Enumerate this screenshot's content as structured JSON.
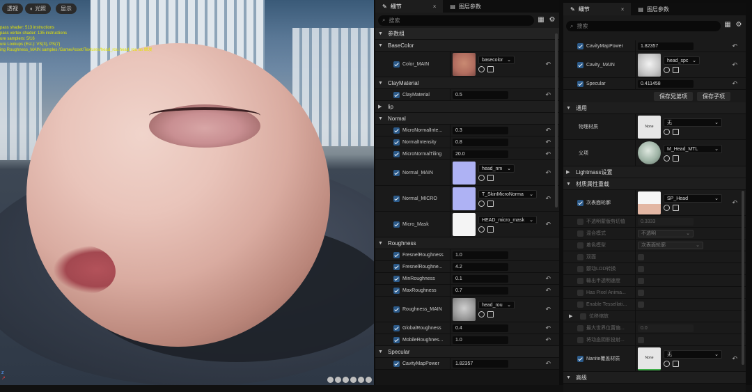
{
  "viewport": {
    "btn_perspective": "透视",
    "btn_lit": "光照",
    "btn_show": "显示",
    "stats": [
      "pass shader: 513 instructions",
      "pass vertex shader: 135 instructions",
      "ure samplers: 5/16",
      "ure Lookups (Est.): VS(3), PS(7)",
      "ing Roughness_MAIN samples /Game/Asset/Textures/head_rou.head_rou as 继发"
    ]
  },
  "panel1": {
    "tab_details": "细节",
    "tab_layer_params": "图层参数",
    "search_placeholder": "搜索",
    "params_group": "参数组",
    "sections": {
      "basecolor": "BaseColor",
      "claymaterial": "ClayMaterial",
      "lip": "lip",
      "normal": "Normal",
      "roughness": "Roughness",
      "specular": "Specular"
    },
    "color_main": {
      "label": "Color_MAIN",
      "asset": "basecolor"
    },
    "claymaterial": {
      "label": "ClayMaterial",
      "value": "0.5"
    },
    "micro_normal_intensity": {
      "label": "MicroNormalInte...",
      "value": "0.3"
    },
    "normal_intensity": {
      "label": "NormalIntensity",
      "value": "0.8"
    },
    "micro_normal_tiling": {
      "label": "MicroNormalTiling",
      "value": "20.0"
    },
    "normal_main": {
      "label": "Normal_MAIN",
      "asset": "head_nm"
    },
    "normal_micro": {
      "label": "Normal_MICRO",
      "asset": "T_SkinMicroNorma"
    },
    "micro_mask": {
      "label": "Micro_Mask",
      "asset": "HEAD_micro_mask"
    },
    "fresnel_roughness": {
      "label": "FresnelRoughness",
      "value": "1.0"
    },
    "fresnel_roughness2": {
      "label": "FresnelRoughne...",
      "value": "4.2"
    },
    "min_roughness": {
      "label": "MinRoughness",
      "value": "0.1"
    },
    "max_roughness": {
      "label": "MaxRoughness",
      "value": "0.7"
    },
    "roughness_main": {
      "label": "Roughness_MAIN",
      "asset": "head_rou"
    },
    "global_roughness": {
      "label": "GlobalRoughness",
      "value": "0.4"
    },
    "mobile_roughness": {
      "label": "MobileRoughnes...",
      "value": "1.0"
    },
    "cavity_map_power": {
      "label": "CavityMapPower",
      "value": "1.82357"
    }
  },
  "panel2": {
    "tab_details": "细节",
    "tab_layer_params": "图层参数",
    "search_placeholder": "搜索",
    "cavity_map_power": {
      "label": "CavityMapPower",
      "value": "1.82357"
    },
    "cavity_main": {
      "label": "Cavity_MAIN",
      "asset": "head_spc"
    },
    "specular": {
      "label": "Specular",
      "value": "0.411458"
    },
    "btn_save_sibling": "保存兄弟项",
    "btn_save_child": "保存子项",
    "sec_general": "通用",
    "physical_material": {
      "label": "物理材质",
      "thumb": "None",
      "asset": "无"
    },
    "parent": {
      "label": "父项",
      "asset": "M_Head_MTL"
    },
    "sec_lightmass": "Lightmass设置",
    "sec_material_overrides": "材质属性重载",
    "subsurface_profile": {
      "label": "次表面轮廓",
      "asset": "SP_Head"
    },
    "opacity_clip": {
      "label": "不透明蒙版剪切值",
      "value": "0.3333"
    },
    "blend_mode": {
      "label": "混合模式",
      "value": "不透明"
    },
    "shading_model": {
      "label": "着色模型",
      "value": "次表面轮廓"
    },
    "two_sided": "双面",
    "dither_lod": "颤动LOD转换",
    "output_translucent_velocity": "输出半透明速度",
    "has_pixel_animation": "Has Pixel Anima...",
    "enable_tessellation": "Enable Tessellati...",
    "displacement_scaling": "位移缩放",
    "max_world_displacement": {
      "label": "最大世界位置偏...",
      "value": "0.0"
    },
    "cast_dynamic_shadow": "将动态阴影投射...",
    "nanite_override": {
      "label": "Nanite覆盖材质",
      "thumb": "None",
      "asset": "无"
    },
    "sec_advanced": "高级"
  }
}
